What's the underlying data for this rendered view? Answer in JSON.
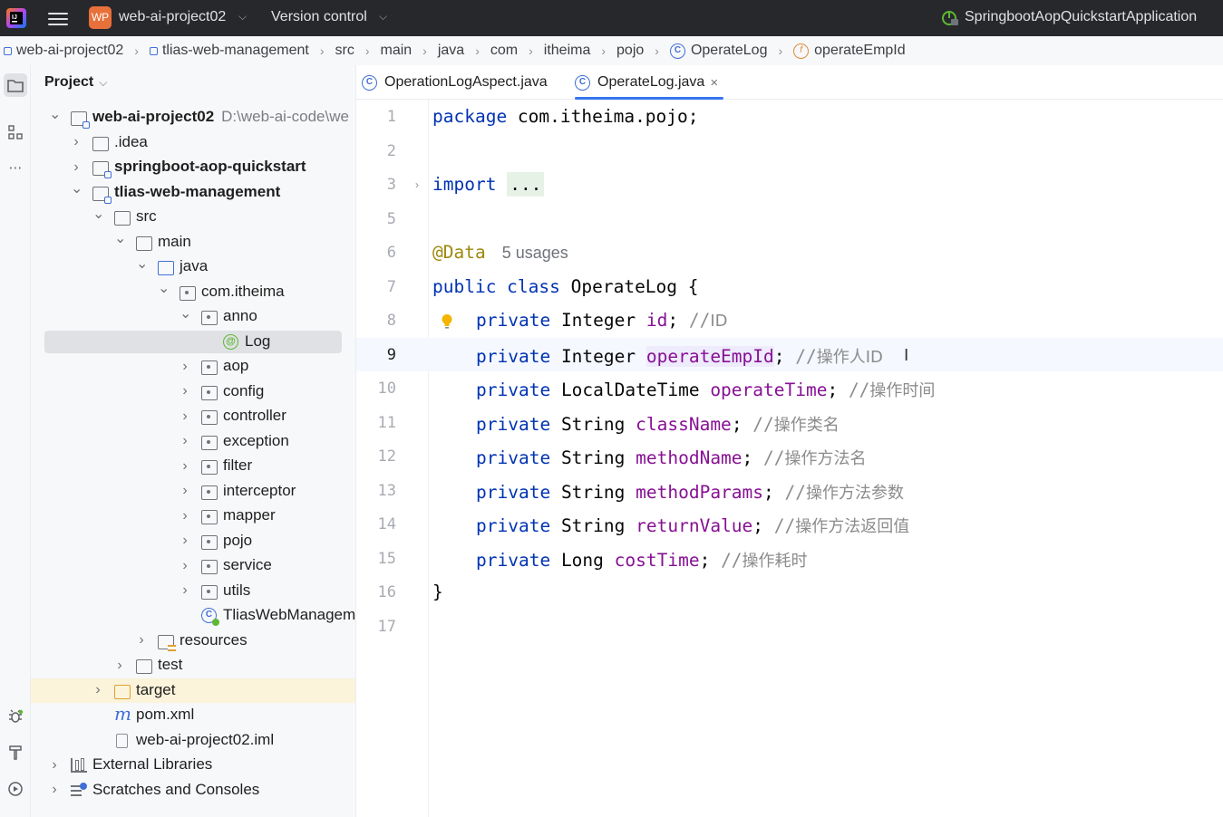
{
  "titlebar": {
    "project_badge": "WP",
    "project_name": "web-ai-project02",
    "vcs_label": "Version control",
    "run_config": "SpringbootAopQuickstartApplication"
  },
  "breadcrumbs": [
    "web-ai-project02",
    "tlias-web-management",
    "src",
    "main",
    "java",
    "com",
    "itheima",
    "pojo",
    "OperateLog",
    "operateEmpId"
  ],
  "project_panel": {
    "title": "Project",
    "tree": [
      {
        "label": "web-ai-project02",
        "path": "D:\\web-ai-code\\we",
        "icon": "module-folder-icon",
        "bold": true,
        "expanded": true
      },
      {
        "label": ".idea",
        "icon": "folder-icon",
        "expanded": false
      },
      {
        "label": "springboot-aop-quickstart",
        "icon": "module-folder-icon",
        "bold": true,
        "expanded": false
      },
      {
        "label": "tlias-web-management",
        "icon": "module-folder-icon",
        "bold": true,
        "expanded": true
      },
      {
        "label": "src",
        "icon": "folder-icon",
        "expanded": true
      },
      {
        "label": "main",
        "icon": "folder-icon",
        "expanded": true
      },
      {
        "label": "java",
        "icon": "source-folder-icon",
        "expanded": true
      },
      {
        "label": "com.itheima",
        "icon": "package-icon",
        "expanded": true
      },
      {
        "label": "anno",
        "icon": "package-icon",
        "expanded": true
      },
      {
        "label": "Log",
        "icon": "annotation-icon",
        "selected": true
      },
      {
        "label": "aop",
        "icon": "package-icon",
        "expanded": false
      },
      {
        "label": "config",
        "icon": "package-icon",
        "expanded": false
      },
      {
        "label": "controller",
        "icon": "package-icon",
        "expanded": false
      },
      {
        "label": "exception",
        "icon": "package-icon",
        "expanded": false
      },
      {
        "label": "filter",
        "icon": "package-icon",
        "expanded": false
      },
      {
        "label": "interceptor",
        "icon": "package-icon",
        "expanded": false
      },
      {
        "label": "mapper",
        "icon": "package-icon",
        "expanded": false
      },
      {
        "label": "pojo",
        "icon": "package-icon",
        "expanded": false
      },
      {
        "label": "service",
        "icon": "package-icon",
        "expanded": false
      },
      {
        "label": "utils",
        "icon": "package-icon",
        "expanded": false
      },
      {
        "label": "TliasWebManageme",
        "icon": "spring-boot-app-icon"
      },
      {
        "label": "resources",
        "icon": "resources-folder-icon",
        "expanded": false
      },
      {
        "label": "test",
        "icon": "folder-icon",
        "expanded": false
      },
      {
        "label": "target",
        "icon": "excluded-folder-icon",
        "expanded": false
      },
      {
        "label": "pom.xml",
        "icon": "maven-icon",
        "glyph": "m"
      },
      {
        "label": "web-ai-project02.iml",
        "icon": "file-icon"
      },
      {
        "label": "External Libraries",
        "icon": "libraries-icon",
        "expanded": false
      },
      {
        "label": "Scratches and Consoles",
        "icon": "scratches-icon",
        "expanded": false
      }
    ]
  },
  "tabs": [
    {
      "label": "OperationLogAspect.java",
      "icon": "class-icon",
      "active": false
    },
    {
      "label": "OperateLog.java",
      "icon": "class-icon",
      "active": true,
      "close": "×"
    }
  ],
  "editor": {
    "line_numbers": [
      "1",
      "2",
      "3",
      "5",
      "6",
      "7",
      "8",
      "9",
      "10",
      "11",
      "12",
      "13",
      "14",
      "15",
      "16",
      "17"
    ],
    "current_line": "9",
    "usages_hint": "5 usages",
    "code": {
      "l1_kw": "package",
      "l1_rest": " com.itheima.pojo;",
      "l3_kw": "import",
      "l3_fold": "...",
      "l6_ann": "@Data",
      "l7_kw": "public class",
      "l7_rest": " OperateLog {",
      "l16": "}"
    },
    "fields": [
      {
        "type": "Integer",
        "name": "id",
        "comment_prefix": "//",
        "comment": "ID"
      },
      {
        "type": "Integer",
        "name": "operateEmpId",
        "comment_prefix": "//",
        "comment": "操作人ID"
      },
      {
        "type": "LocalDateTime",
        "name": "operateTime",
        "comment_prefix": "//",
        "comment": "操作时间"
      },
      {
        "type": "String",
        "name": "className",
        "comment_prefix": "//",
        "comment": "操作类名"
      },
      {
        "type": "String",
        "name": "methodName",
        "comment_prefix": "//",
        "comment": "操作方法名"
      },
      {
        "type": "String",
        "name": "methodParams",
        "comment_prefix": "//",
        "comment": "操作方法参数"
      },
      {
        "type": "String",
        "name": "returnValue",
        "comment_prefix": "//",
        "comment": "操作方法返回值"
      },
      {
        "type": "Long",
        "name": "costTime",
        "comment_prefix": "//",
        "comment": "操作耗时"
      }
    ],
    "field_modifier": "private",
    "text_cursor": "I"
  },
  "colors": {
    "keyword": "#0033b3",
    "annotation": "#9e880d",
    "field": "#871094",
    "comment": "#8c8c8c",
    "titlebar_bg": "#27282c",
    "accent": "#3574f0"
  }
}
